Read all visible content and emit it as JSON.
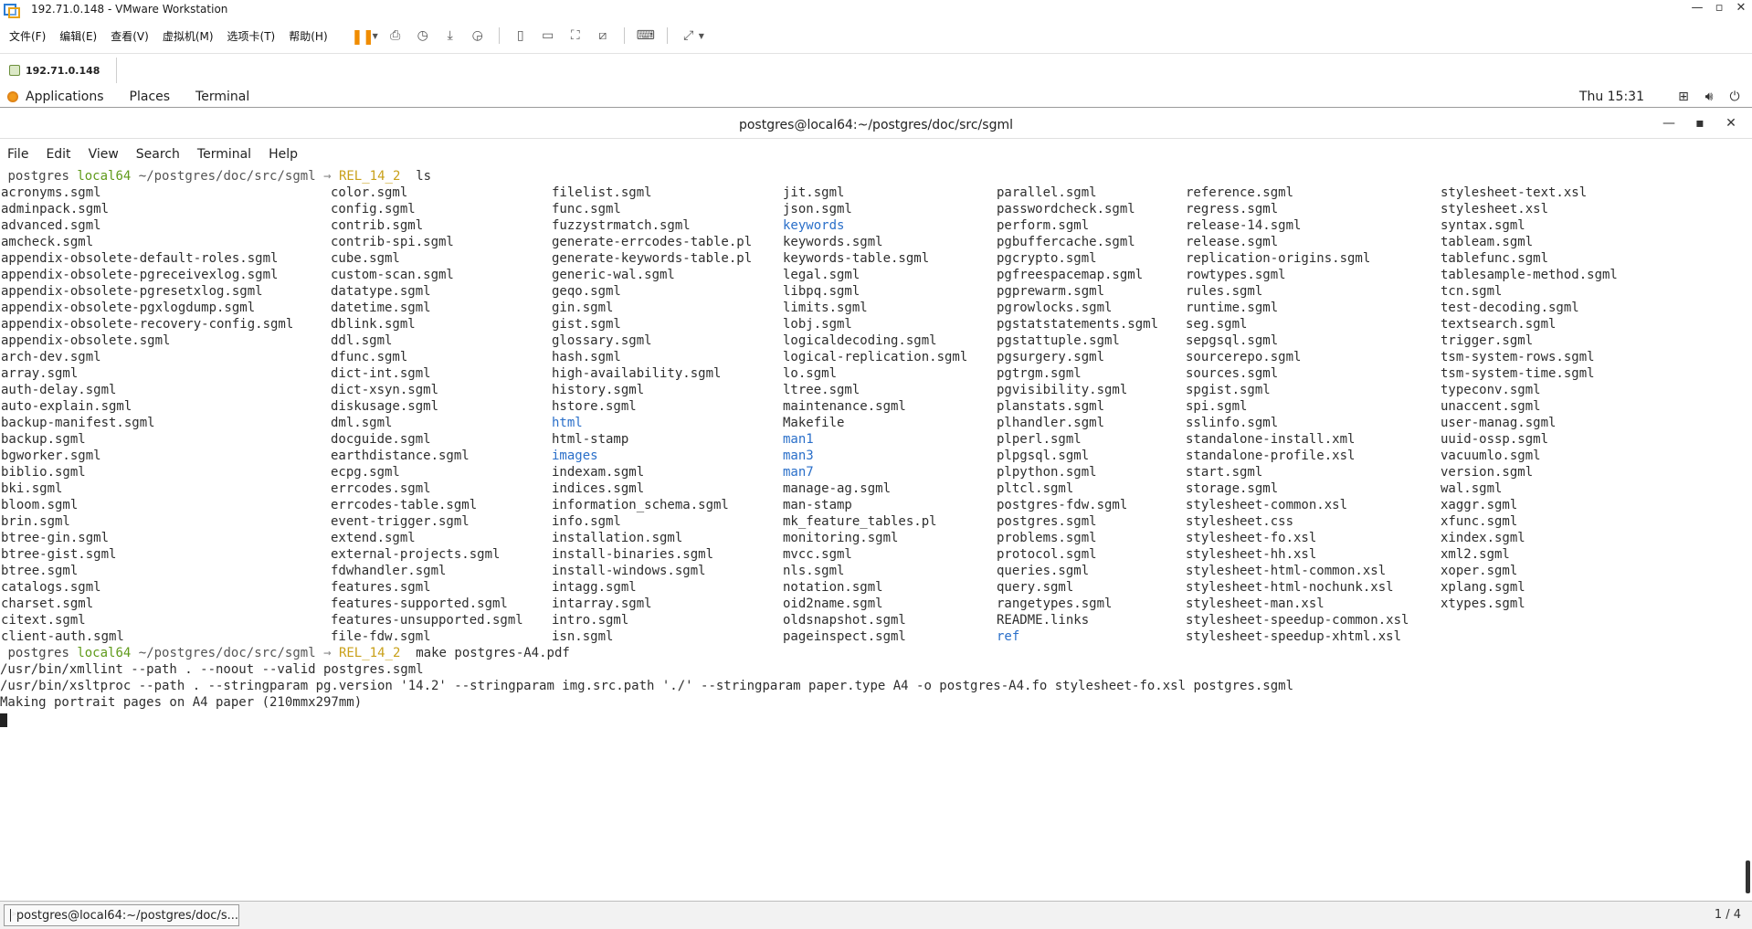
{
  "vmware": {
    "title": "192.71.0.148 - VMware Workstation",
    "menu": [
      "文件(F)",
      "编辑(E)",
      "查看(V)",
      "虚拟机(M)",
      "选项卡(T)",
      "帮助(H)"
    ],
    "tab_label": "192.71.0.148"
  },
  "gnome": {
    "applications": "Applications",
    "places": "Places",
    "terminal": "Terminal",
    "clock": "Thu 15:31"
  },
  "terminal_window": {
    "title": "postgres@local64:~/postgres/doc/src/sgml",
    "menu": [
      "File",
      "Edit",
      "View",
      "Search",
      "Terminal",
      "Help"
    ]
  },
  "prompt": {
    "user": "postgres",
    "host": "local64",
    "path": "~/postgres/doc/src/sgml",
    "arrow": "→",
    "branch": "REL_14_2"
  },
  "command1": "ls",
  "ls_columns": [
    [
      "acronyms.sgml",
      "adminpack.sgml",
      "advanced.sgml",
      "amcheck.sgml",
      "appendix-obsolete-default-roles.sgml",
      "appendix-obsolete-pgreceivexlog.sgml",
      "appendix-obsolete-pgresetxlog.sgml",
      "appendix-obsolete-pgxlogdump.sgml",
      "appendix-obsolete-recovery-config.sgml",
      "appendix-obsolete.sgml",
      "arch-dev.sgml",
      "array.sgml",
      "auth-delay.sgml",
      "auto-explain.sgml",
      "backup-manifest.sgml",
      "backup.sgml",
      "bgworker.sgml",
      "biblio.sgml",
      "bki.sgml",
      "bloom.sgml",
      "brin.sgml",
      "btree-gin.sgml",
      "btree-gist.sgml",
      "btree.sgml",
      "catalogs.sgml",
      "charset.sgml",
      "citext.sgml",
      "client-auth.sgml"
    ],
    [
      "color.sgml",
      "config.sgml",
      "contrib.sgml",
      "contrib-spi.sgml",
      "cube.sgml",
      "custom-scan.sgml",
      "datatype.sgml",
      "datetime.sgml",
      "dblink.sgml",
      "ddl.sgml",
      "dfunc.sgml",
      "dict-int.sgml",
      "dict-xsyn.sgml",
      "diskusage.sgml",
      "dml.sgml",
      "docguide.sgml",
      "earthdistance.sgml",
      "ecpg.sgml",
      "errcodes.sgml",
      "errcodes-table.sgml",
      "event-trigger.sgml",
      "extend.sgml",
      "external-projects.sgml",
      "fdwhandler.sgml",
      "features.sgml",
      "features-supported.sgml",
      "features-unsupported.sgml",
      "file-fdw.sgml"
    ],
    [
      "filelist.sgml",
      "func.sgml",
      "fuzzystrmatch.sgml",
      "generate-errcodes-table.pl",
      "generate-keywords-table.pl",
      "generic-wal.sgml",
      "geqo.sgml",
      "gin.sgml",
      "gist.sgml",
      "glossary.sgml",
      "hash.sgml",
      "high-availability.sgml",
      "history.sgml",
      "hstore.sgml",
      "html",
      "html-stamp",
      "images",
      "indexam.sgml",
      "indices.sgml",
      "information_schema.sgml",
      "info.sgml",
      "installation.sgml",
      "install-binaries.sgml",
      "install-windows.sgml",
      "intagg.sgml",
      "intarray.sgml",
      "intro.sgml",
      "isn.sgml"
    ],
    [
      "jit.sgml",
      "json.sgml",
      "keywords",
      "keywords.sgml",
      "keywords-table.sgml",
      "legal.sgml",
      "libpq.sgml",
      "limits.sgml",
      "lobj.sgml",
      "logicaldecoding.sgml",
      "logical-replication.sgml",
      "lo.sgml",
      "ltree.sgml",
      "maintenance.sgml",
      "Makefile",
      "man1",
      "man3",
      "man7",
      "manage-ag.sgml",
      "man-stamp",
      "mk_feature_tables.pl",
      "monitoring.sgml",
      "mvcc.sgml",
      "nls.sgml",
      "notation.sgml",
      "oid2name.sgml",
      "oldsnapshot.sgml",
      "pageinspect.sgml"
    ],
    [
      "parallel.sgml",
      "passwordcheck.sgml",
      "perform.sgml",
      "pgbuffercache.sgml",
      "pgcrypto.sgml",
      "pgfreespacemap.sgml",
      "pgprewarm.sgml",
      "pgrowlocks.sgml",
      "pgstatstatements.sgml",
      "pgstattuple.sgml",
      "pgsurgery.sgml",
      "pgtrgm.sgml",
      "pgvisibility.sgml",
      "planstats.sgml",
      "plhandler.sgml",
      "plperl.sgml",
      "plpgsql.sgml",
      "plpython.sgml",
      "pltcl.sgml",
      "postgres-fdw.sgml",
      "postgres.sgml",
      "problems.sgml",
      "protocol.sgml",
      "queries.sgml",
      "query.sgml",
      "rangetypes.sgml",
      "README.links",
      "ref"
    ],
    [
      "reference.sgml",
      "regress.sgml",
      "release-14.sgml",
      "release.sgml",
      "replication-origins.sgml",
      "rowtypes.sgml",
      "rules.sgml",
      "runtime.sgml",
      "seg.sgml",
      "sepgsql.sgml",
      "sourcerepo.sgml",
      "sources.sgml",
      "spgist.sgml",
      "spi.sgml",
      "sslinfo.sgml",
      "standalone-install.xml",
      "standalone-profile.xsl",
      "start.sgml",
      "storage.sgml",
      "stylesheet-common.xsl",
      "stylesheet.css",
      "stylesheet-fo.xsl",
      "stylesheet-hh.xsl",
      "stylesheet-html-common.xsl",
      "stylesheet-html-nochunk.xsl",
      "stylesheet-man.xsl",
      "stylesheet-speedup-common.xsl",
      "stylesheet-speedup-xhtml.xsl"
    ],
    [
      "stylesheet-text.xsl",
      "stylesheet.xsl",
      "syntax.sgml",
      "tableam.sgml",
      "tablefunc.sgml",
      "tablesample-method.sgml",
      "tcn.sgml",
      "test-decoding.sgml",
      "textsearch.sgml",
      "trigger.sgml",
      "tsm-system-rows.sgml",
      "tsm-system-time.sgml",
      "typeconv.sgml",
      "unaccent.sgml",
      "user-manag.sgml",
      "uuid-ossp.sgml",
      "vacuumlo.sgml",
      "version.sgml",
      "wal.sgml",
      "xaggr.sgml",
      "xfunc.sgml",
      "xindex.sgml",
      "xml2.sgml",
      "xoper.sgml",
      "xplang.sgml",
      "xtypes.sgml"
    ]
  ],
  "directories": [
    "html",
    "images",
    "keywords",
    "man1",
    "man3",
    "man7",
    "ref"
  ],
  "command2": "make postgres-A4.pdf",
  "output": [
    "/usr/bin/xmllint --path . --noout --valid postgres.sgml",
    "/usr/bin/xsltproc --path . --stringparam pg.version '14.2' --stringparam img.src.path './' --stringparam paper.type A4 -o postgres-A4.fo stylesheet-fo.xsl postgres.sgml",
    "Making portrait pages on A4 paper (210mmx297mm)"
  ],
  "taskbar": {
    "item": "postgres@local64:~/postgres/doc/s...",
    "workspace": "1 / 4"
  },
  "colors": {
    "host": "#5f9a1a",
    "branch": "#c9a019",
    "directory": "#2a6fc9",
    "vmware_pause": "#f08c00"
  }
}
